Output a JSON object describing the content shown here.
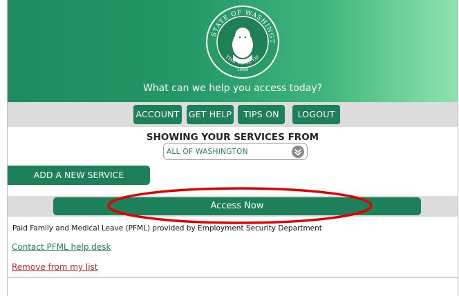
{
  "hero": {
    "seal": {
      "text_top": "THE STATE OF WASHINGTON",
      "text_bottom": "THE SEAL OF",
      "year": "1889"
    },
    "tagline": "What can we help you access today?"
  },
  "nav": {
    "buttons": [
      "ACCOUNT",
      "GET HELP",
      "TIPS ON",
      "LOGOUT"
    ]
  },
  "services": {
    "heading": "SHOWING YOUR SERVICES FROM",
    "filter_value": "ALL OF WASHINGTON",
    "add_label": "ADD A NEW SERVICE"
  },
  "service_card": {
    "access_label": "Access Now",
    "description": "Paid Family and Medical Leave (PFML) provided by Employment Security Department",
    "contact_link": "Contact PFML help desk",
    "remove_link": "Remove from my list"
  },
  "colors": {
    "brand_green": "#1e7f5b",
    "hero_light": "#8fe3b0",
    "band_gray": "#dcdcdc",
    "remove_red": "#c62828",
    "annotation_red": "#e00000"
  }
}
